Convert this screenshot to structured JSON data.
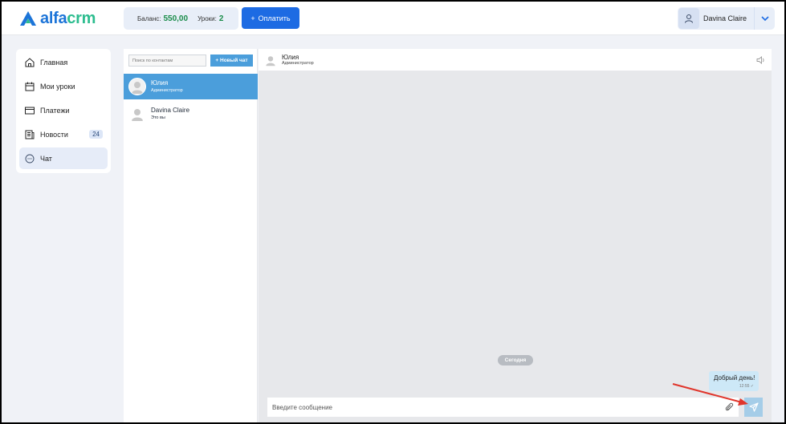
{
  "header": {
    "logo_text_main": "alfa",
    "logo_text_accent": "crm",
    "balance_label": "Баланс:",
    "balance_value": "550,00",
    "lessons_label": "Уроки:",
    "lessons_value": "2",
    "pay_icon": "+",
    "pay_label": "Оплатить",
    "user_name": "Davina Claire"
  },
  "nav": {
    "items": [
      {
        "label": "Главная",
        "icon": "home-icon"
      },
      {
        "label": "Мои уроки",
        "icon": "calendar-icon"
      },
      {
        "label": "Платежи",
        "icon": "card-icon"
      },
      {
        "label": "Новости",
        "icon": "news-icon",
        "badge": "24"
      },
      {
        "label": "Чат",
        "icon": "chat-icon"
      }
    ]
  },
  "contacts": {
    "search_placeholder": "Поиск по контактам",
    "new_chat_label": "+ Новый чат",
    "list": [
      {
        "name": "Юлия",
        "role": "Администратор"
      },
      {
        "name": "Davina Claire",
        "role": "Это вы"
      }
    ]
  },
  "chat": {
    "header_name": "Юлия",
    "header_role": "Администратор",
    "date_label": "Сегодня",
    "messages": [
      {
        "text": "Добрый день!",
        "time": "12:55"
      }
    ],
    "compose_placeholder": "Введите сообщение"
  },
  "colors": {
    "brand_blue": "#1c74d8",
    "brand_green": "#2dbd8f",
    "pay_button": "#1d6be3",
    "active_contact": "#4b9edb",
    "annotation_arrow": "#e0352b"
  }
}
